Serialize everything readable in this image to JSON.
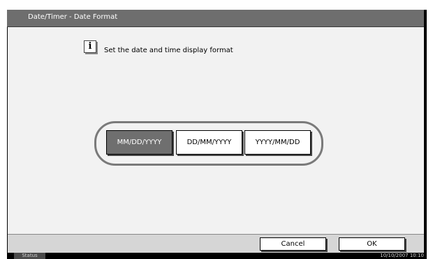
{
  "header": {
    "title": "Date/Timer - Date Format"
  },
  "message": "Set the date and time display format",
  "info_icon": {
    "glyph": "i",
    "name": "info-icon"
  },
  "formats": [
    {
      "label": "MM/DD/YYYY",
      "selected": true
    },
    {
      "label": "DD/MM/YYYY",
      "selected": false
    },
    {
      "label": "YYYY/MM/DD",
      "selected": false
    }
  ],
  "actions": {
    "cancel": "Cancel",
    "ok": "OK"
  },
  "status": {
    "label": "Status",
    "datetime": "10/10/2007  10:10"
  },
  "colors": {
    "titlebar": "#6e6e6e",
    "selected_button": "#6f6f6f",
    "panel": "#f2f2f2"
  }
}
